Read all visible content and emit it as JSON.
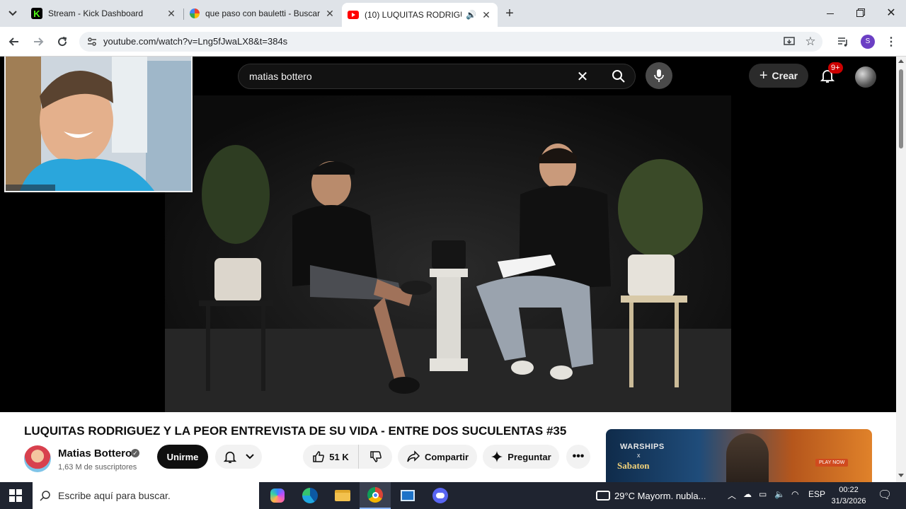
{
  "browser": {
    "tabs": [
      {
        "title": "Stream - Kick Dashboard",
        "favicon": "kick-icon",
        "active": false
      },
      {
        "title": "que paso con bauletti - Buscar",
        "favicon": "google-icon",
        "active": false
      },
      {
        "title": "(10) LUQUITAS RODRIGUEZ",
        "favicon": "youtube-icon",
        "active": true
      }
    ],
    "url": "youtube.com/watch?v=Lng5fJwaLX8&t=384s",
    "profile_initial": "S"
  },
  "youtube": {
    "search_query": "matias bottero",
    "create_label": "Crear",
    "notification_badge": "9+",
    "video_title": "LUQUITAS RODRIGUEZ Y LA PEOR ENTREVISTA DE SU VIDA - ENTRE DOS SUCULENTAS #35",
    "channel_name": "Matias Bottero",
    "subscribers": "1,63 M de suscriptores",
    "subscribe_label": "Unirme",
    "like_count": "51 K",
    "share_label": "Compartir",
    "ask_label": "Preguntar",
    "ad": {
      "headline": "WARSHIPS",
      "sub": "x",
      "brand": "Sabaton",
      "cta": "PLAY NOW"
    }
  },
  "taskbar": {
    "search_placeholder": "Escribe aquí para buscar.",
    "weather": "29°C  Mayorm. nubla...",
    "language": "ESP",
    "time": "00:22",
    "date": "31/3/2026"
  },
  "colors": {
    "youtube_red": "#ff0000",
    "kick_green": "#53fc18",
    "taskbar_bg": "#1f2430"
  }
}
